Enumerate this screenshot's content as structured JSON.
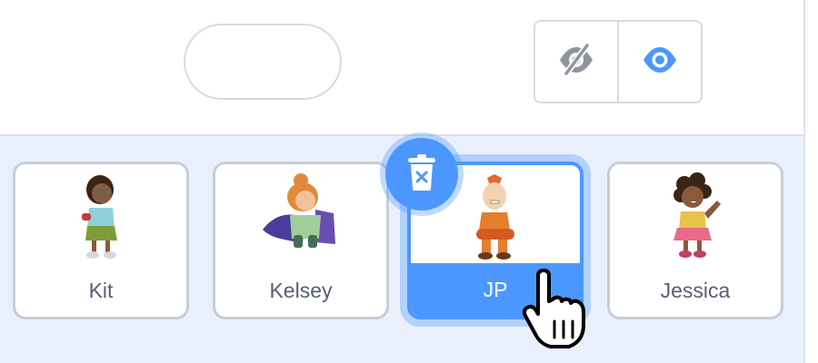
{
  "header": {
    "visibility": {
      "hidden_icon": "eye-slash-icon",
      "shown_icon": "eye-icon",
      "active": "shown"
    }
  },
  "sprites": [
    {
      "name": "Kit",
      "selected": false
    },
    {
      "name": "Kelsey",
      "selected": false
    },
    {
      "name": "JP",
      "selected": true
    },
    {
      "name": "Jessica",
      "selected": false
    }
  ],
  "delete_icon": "trash-x-icon",
  "colors": {
    "accent": "#4c97ff",
    "pane_bg": "#e9f0fb",
    "tile_border": "#c8ced8",
    "label_text": "#575e75",
    "icon_gray": "#8f959e"
  }
}
